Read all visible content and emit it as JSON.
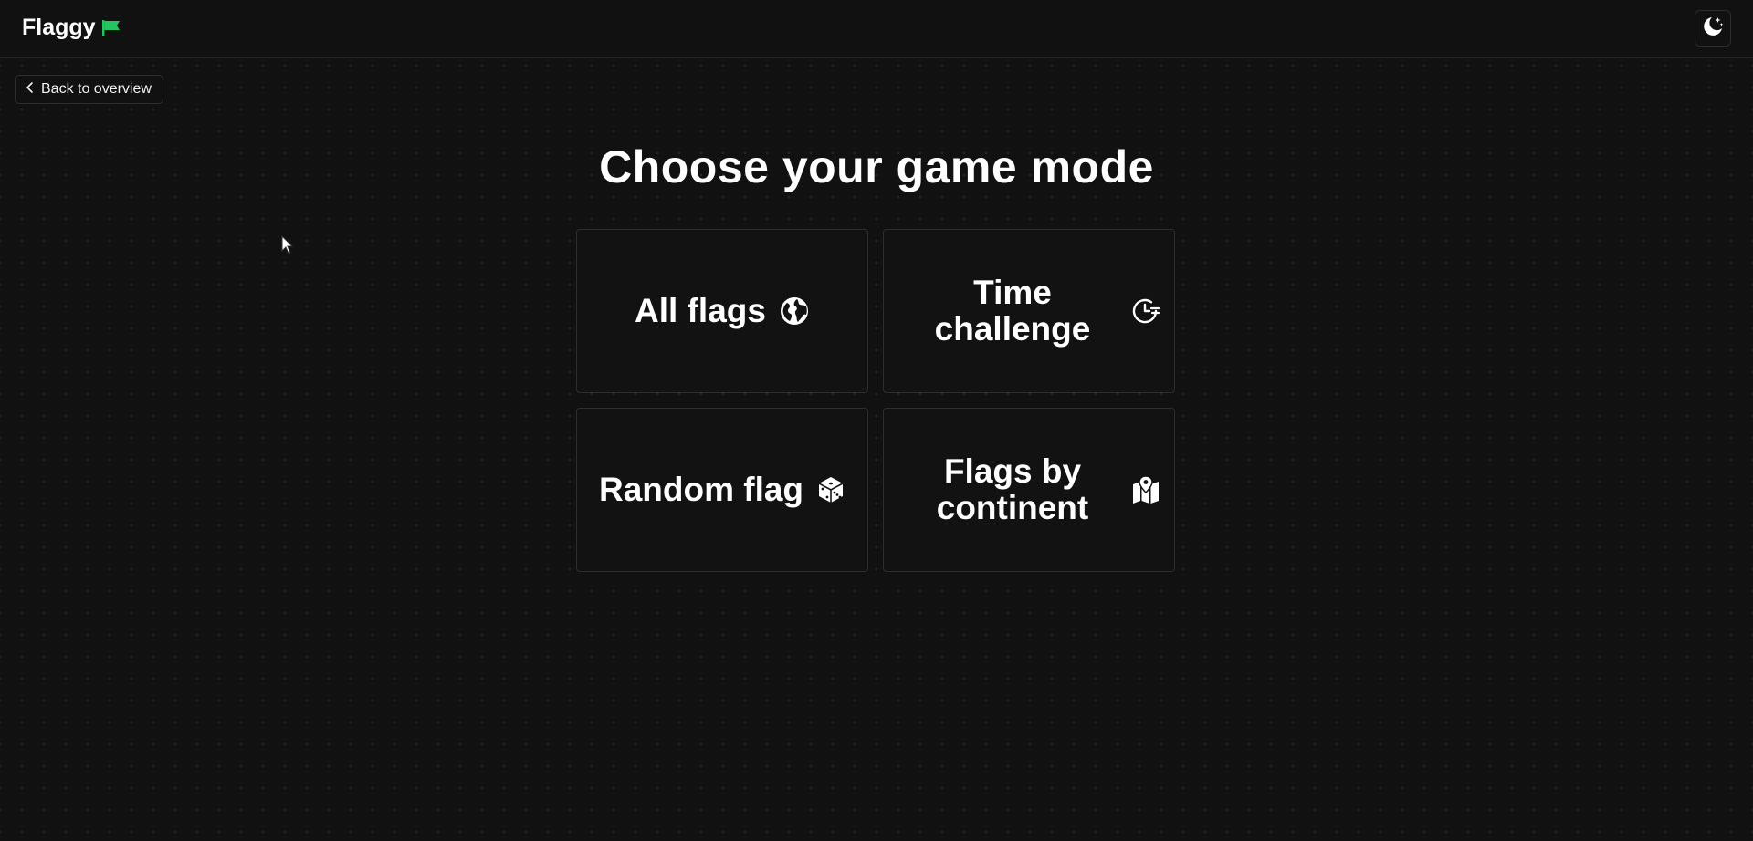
{
  "header": {
    "app_name": "Flaggy",
    "logo_icon": "green-flag-icon",
    "theme_toggle_icon": "moon-stars-icon"
  },
  "nav": {
    "back_label": "Back to overview",
    "back_icon": "chevron-left-icon"
  },
  "main": {
    "title": "Choose your game mode",
    "modes": [
      {
        "label": "All flags",
        "icon": "globe-icon"
      },
      {
        "label": "Time challenge",
        "icon": "clock-icon"
      },
      {
        "label": "Random flag",
        "icon": "dice-icon"
      },
      {
        "label": "Flags by continent",
        "icon": "map-pin-icon"
      }
    ]
  },
  "colors": {
    "background": "#111111",
    "accent": "#22c55e",
    "text": "#ffffff",
    "border": "#2e2e2e"
  }
}
